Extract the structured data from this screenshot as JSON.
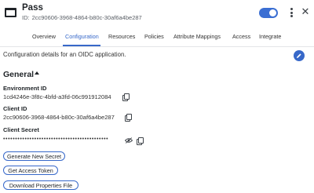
{
  "app": {
    "name": "Pass",
    "id_prefix": "ID:",
    "id_value": "2cc90606-3968-4864-b80c-30af6a4be287",
    "enabled": true
  },
  "tabs": [
    "Overview",
    "Configuration",
    "Resources",
    "Policies",
    "Attribute Mappings",
    "Access",
    "Integrate"
  ],
  "active_tab": "Configuration",
  "description": "Configuration details for an OIDC application.",
  "section": {
    "title": "General"
  },
  "fields": {
    "environment_id": {
      "label": "Environment ID",
      "value": "1cd4246e-3f8c-4bfd-a3fd-06c991912084"
    },
    "client_id": {
      "label": "Client ID",
      "value": "2cc90606-3968-4864-b80c-30af6a4be287"
    },
    "client_secret": {
      "label": "Client Secret",
      "value": "••••••••••••••••••••••••••••••••••••••••••••"
    }
  },
  "buttons": {
    "generate_secret": "Generate New Secret",
    "get_token": "Get Access Token",
    "download_properties": "Download Properties File"
  },
  "colors": {
    "accent": "#3768c9",
    "toggle": "#3b6fd3"
  },
  "icons": [
    "app-window-icon",
    "kebab-menu-icon",
    "close-icon",
    "edit-pencil-icon",
    "copy-icon",
    "eye-off-icon",
    "caret-up-icon"
  ]
}
